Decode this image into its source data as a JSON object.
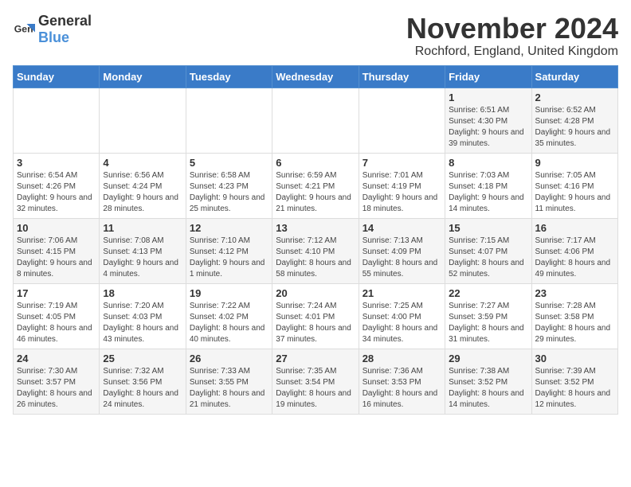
{
  "logo": {
    "text_general": "General",
    "text_blue": "Blue"
  },
  "title": {
    "month_year": "November 2024",
    "location": "Rochford, England, United Kingdom"
  },
  "headers": [
    "Sunday",
    "Monday",
    "Tuesday",
    "Wednesday",
    "Thursday",
    "Friday",
    "Saturday"
  ],
  "weeks": [
    [
      {
        "day": "",
        "sunrise": "",
        "sunset": "",
        "daylight": ""
      },
      {
        "day": "",
        "sunrise": "",
        "sunset": "",
        "daylight": ""
      },
      {
        "day": "",
        "sunrise": "",
        "sunset": "",
        "daylight": ""
      },
      {
        "day": "",
        "sunrise": "",
        "sunset": "",
        "daylight": ""
      },
      {
        "day": "",
        "sunrise": "",
        "sunset": "",
        "daylight": ""
      },
      {
        "day": "1",
        "sunrise": "Sunrise: 6:51 AM",
        "sunset": "Sunset: 4:30 PM",
        "daylight": "Daylight: 9 hours and 39 minutes."
      },
      {
        "day": "2",
        "sunrise": "Sunrise: 6:52 AM",
        "sunset": "Sunset: 4:28 PM",
        "daylight": "Daylight: 9 hours and 35 minutes."
      }
    ],
    [
      {
        "day": "3",
        "sunrise": "Sunrise: 6:54 AM",
        "sunset": "Sunset: 4:26 PM",
        "daylight": "Daylight: 9 hours and 32 minutes."
      },
      {
        "day": "4",
        "sunrise": "Sunrise: 6:56 AM",
        "sunset": "Sunset: 4:24 PM",
        "daylight": "Daylight: 9 hours and 28 minutes."
      },
      {
        "day": "5",
        "sunrise": "Sunrise: 6:58 AM",
        "sunset": "Sunset: 4:23 PM",
        "daylight": "Daylight: 9 hours and 25 minutes."
      },
      {
        "day": "6",
        "sunrise": "Sunrise: 6:59 AM",
        "sunset": "Sunset: 4:21 PM",
        "daylight": "Daylight: 9 hours and 21 minutes."
      },
      {
        "day": "7",
        "sunrise": "Sunrise: 7:01 AM",
        "sunset": "Sunset: 4:19 PM",
        "daylight": "Daylight: 9 hours and 18 minutes."
      },
      {
        "day": "8",
        "sunrise": "Sunrise: 7:03 AM",
        "sunset": "Sunset: 4:18 PM",
        "daylight": "Daylight: 9 hours and 14 minutes."
      },
      {
        "day": "9",
        "sunrise": "Sunrise: 7:05 AM",
        "sunset": "Sunset: 4:16 PM",
        "daylight": "Daylight: 9 hours and 11 minutes."
      }
    ],
    [
      {
        "day": "10",
        "sunrise": "Sunrise: 7:06 AM",
        "sunset": "Sunset: 4:15 PM",
        "daylight": "Daylight: 9 hours and 8 minutes."
      },
      {
        "day": "11",
        "sunrise": "Sunrise: 7:08 AM",
        "sunset": "Sunset: 4:13 PM",
        "daylight": "Daylight: 9 hours and 4 minutes."
      },
      {
        "day": "12",
        "sunrise": "Sunrise: 7:10 AM",
        "sunset": "Sunset: 4:12 PM",
        "daylight": "Daylight: 9 hours and 1 minute."
      },
      {
        "day": "13",
        "sunrise": "Sunrise: 7:12 AM",
        "sunset": "Sunset: 4:10 PM",
        "daylight": "Daylight: 8 hours and 58 minutes."
      },
      {
        "day": "14",
        "sunrise": "Sunrise: 7:13 AM",
        "sunset": "Sunset: 4:09 PM",
        "daylight": "Daylight: 8 hours and 55 minutes."
      },
      {
        "day": "15",
        "sunrise": "Sunrise: 7:15 AM",
        "sunset": "Sunset: 4:07 PM",
        "daylight": "Daylight: 8 hours and 52 minutes."
      },
      {
        "day": "16",
        "sunrise": "Sunrise: 7:17 AM",
        "sunset": "Sunset: 4:06 PM",
        "daylight": "Daylight: 8 hours and 49 minutes."
      }
    ],
    [
      {
        "day": "17",
        "sunrise": "Sunrise: 7:19 AM",
        "sunset": "Sunset: 4:05 PM",
        "daylight": "Daylight: 8 hours and 46 minutes."
      },
      {
        "day": "18",
        "sunrise": "Sunrise: 7:20 AM",
        "sunset": "Sunset: 4:03 PM",
        "daylight": "Daylight: 8 hours and 43 minutes."
      },
      {
        "day": "19",
        "sunrise": "Sunrise: 7:22 AM",
        "sunset": "Sunset: 4:02 PM",
        "daylight": "Daylight: 8 hours and 40 minutes."
      },
      {
        "day": "20",
        "sunrise": "Sunrise: 7:24 AM",
        "sunset": "Sunset: 4:01 PM",
        "daylight": "Daylight: 8 hours and 37 minutes."
      },
      {
        "day": "21",
        "sunrise": "Sunrise: 7:25 AM",
        "sunset": "Sunset: 4:00 PM",
        "daylight": "Daylight: 8 hours and 34 minutes."
      },
      {
        "day": "22",
        "sunrise": "Sunrise: 7:27 AM",
        "sunset": "Sunset: 3:59 PM",
        "daylight": "Daylight: 8 hours and 31 minutes."
      },
      {
        "day": "23",
        "sunrise": "Sunrise: 7:28 AM",
        "sunset": "Sunset: 3:58 PM",
        "daylight": "Daylight: 8 hours and 29 minutes."
      }
    ],
    [
      {
        "day": "24",
        "sunrise": "Sunrise: 7:30 AM",
        "sunset": "Sunset: 3:57 PM",
        "daylight": "Daylight: 8 hours and 26 minutes."
      },
      {
        "day": "25",
        "sunrise": "Sunrise: 7:32 AM",
        "sunset": "Sunset: 3:56 PM",
        "daylight": "Daylight: 8 hours and 24 minutes."
      },
      {
        "day": "26",
        "sunrise": "Sunrise: 7:33 AM",
        "sunset": "Sunset: 3:55 PM",
        "daylight": "Daylight: 8 hours and 21 minutes."
      },
      {
        "day": "27",
        "sunrise": "Sunrise: 7:35 AM",
        "sunset": "Sunset: 3:54 PM",
        "daylight": "Daylight: 8 hours and 19 minutes."
      },
      {
        "day": "28",
        "sunrise": "Sunrise: 7:36 AM",
        "sunset": "Sunset: 3:53 PM",
        "daylight": "Daylight: 8 hours and 16 minutes."
      },
      {
        "day": "29",
        "sunrise": "Sunrise: 7:38 AM",
        "sunset": "Sunset: 3:52 PM",
        "daylight": "Daylight: 8 hours and 14 minutes."
      },
      {
        "day": "30",
        "sunrise": "Sunrise: 7:39 AM",
        "sunset": "Sunset: 3:52 PM",
        "daylight": "Daylight: 8 hours and 12 minutes."
      }
    ]
  ]
}
